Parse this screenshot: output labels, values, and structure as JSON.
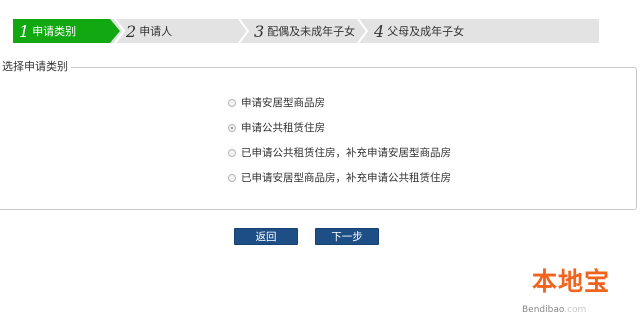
{
  "steps": [
    {
      "num": "1",
      "label": "申请类别",
      "active": true
    },
    {
      "num": "2",
      "label": "申请人",
      "active": false
    },
    {
      "num": "3",
      "label": "配偶及未成年子女",
      "active": false
    },
    {
      "num": "4",
      "label": "父母及成年子女",
      "active": false
    }
  ],
  "section": {
    "legend": "选择申请类别",
    "options": [
      {
        "label": "申请安居型商品房",
        "checked": false
      },
      {
        "label": "申请公共租赁住房",
        "checked": true
      },
      {
        "label": "已申请公共租赁住房，补充申请安居型商品房",
        "checked": false
      },
      {
        "label": "已申请安居型商品房，补充申请公共租赁住房",
        "checked": false
      }
    ]
  },
  "buttons": {
    "back": "返回",
    "next": "下一步"
  },
  "watermark": {
    "title": "本地宝",
    "url_name": "Bendibao",
    "url_domain": ".com"
  },
  "colors": {
    "active_step": "#12a812",
    "step_bg": "#e3e3e3",
    "button": "#1d4f86",
    "watermark": "#f0641e"
  }
}
